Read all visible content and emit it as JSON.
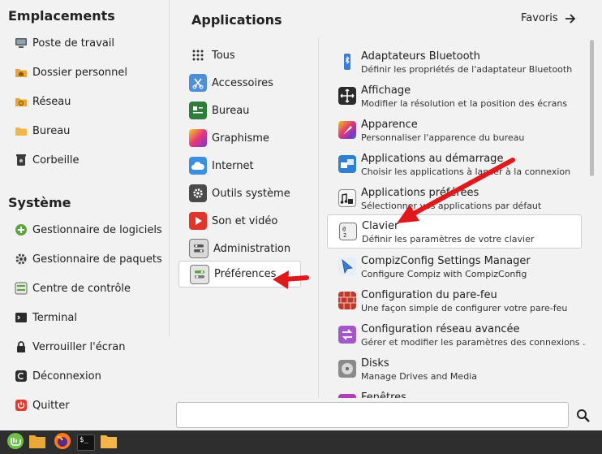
{
  "places": {
    "title": "Emplacements",
    "items": [
      {
        "label": "Poste de travail",
        "icon": "computer-icon"
      },
      {
        "label": "Dossier personnel",
        "icon": "home-folder-icon"
      },
      {
        "label": "Réseau",
        "icon": "network-folder-icon"
      },
      {
        "label": "Bureau",
        "icon": "desktop-folder-icon"
      },
      {
        "label": "Corbeille",
        "icon": "trash-icon"
      }
    ]
  },
  "system": {
    "title": "Système",
    "items": [
      {
        "label": "Gestionnaire de logiciels",
        "icon": "software-manager-icon"
      },
      {
        "label": "Gestionnaire de paquets",
        "icon": "package-manager-icon"
      },
      {
        "label": "Centre de contrôle",
        "icon": "control-center-icon"
      },
      {
        "label": "Terminal",
        "icon": "terminal-icon"
      },
      {
        "label": "Verrouiller l'écran",
        "icon": "lock-icon"
      },
      {
        "label": "Déconnexion",
        "icon": "logout-icon"
      },
      {
        "label": "Quitter",
        "icon": "power-icon"
      }
    ]
  },
  "header": {
    "title": "Applications",
    "favorites_label": "Favoris"
  },
  "categories": [
    {
      "label": "Tous",
      "icon": "grid-icon"
    },
    {
      "label": "Accessoires",
      "icon": "accessories-icon"
    },
    {
      "label": "Bureau",
      "icon": "office-icon"
    },
    {
      "label": "Graphisme",
      "icon": "graphics-icon"
    },
    {
      "label": "Internet",
      "icon": "internet-icon"
    },
    {
      "label": "Outils système",
      "icon": "system-tools-icon"
    },
    {
      "label": "Son et vidéo",
      "icon": "sound-video-icon"
    },
    {
      "label": "Administration",
      "icon": "administration-icon"
    },
    {
      "label": "Préférences",
      "icon": "preferences-icon",
      "selected": true
    }
  ],
  "apps": [
    {
      "name": "Adaptateurs Bluetooth",
      "desc": "Définir les propriétés de l'adaptateur Bluetooth",
      "icon": "bluetooth-icon"
    },
    {
      "name": "Affichage",
      "desc": "Modifier la résolution et la position des écrans",
      "icon": "display-icon"
    },
    {
      "name": "Apparence",
      "desc": "Personnaliser l'apparence du bureau",
      "icon": "appearance-icon"
    },
    {
      "name": "Applications au démarrage",
      "desc": "Choisir les applications à lancer à la connexion",
      "icon": "startup-apps-icon"
    },
    {
      "name": "Applications préférées",
      "desc": "Sélectionner vos applications par défaut",
      "icon": "preferred-apps-icon"
    },
    {
      "name": "Clavier",
      "desc": "Définir les paramètres de votre clavier",
      "icon": "keyboard-icon",
      "selected": true
    },
    {
      "name": "CompizConfig Settings Manager",
      "desc": "Configure Compiz with CompizConfig",
      "icon": "compiz-icon"
    },
    {
      "name": "Configuration du pare-feu",
      "desc": "Une façon simple de configurer votre pare-feu",
      "icon": "firewall-icon"
    },
    {
      "name": "Configuration réseau avancée",
      "desc": "Gérer et modifier les paramètres des connexions …",
      "icon": "network-config-icon"
    },
    {
      "name": "Disks",
      "desc": "Manage Drives and Media",
      "icon": "disks-icon"
    },
    {
      "name": "Fenêtres",
      "desc": "",
      "icon": "windows-icon"
    }
  ],
  "search": {
    "value": "",
    "placeholder": ""
  },
  "taskbar": [
    {
      "icon": "mint-menu-icon"
    },
    {
      "icon": "files-icon"
    },
    {
      "icon": "firefox-icon"
    },
    {
      "icon": "terminal-icon",
      "label": "$_"
    },
    {
      "icon": "folder-icon"
    }
  ],
  "colors": {
    "accent_red": "#e0191c",
    "menu_bg": "#f2f2f2",
    "taskbar_bg": "#2e2e2e",
    "mint_green": "#6fbf4a"
  }
}
